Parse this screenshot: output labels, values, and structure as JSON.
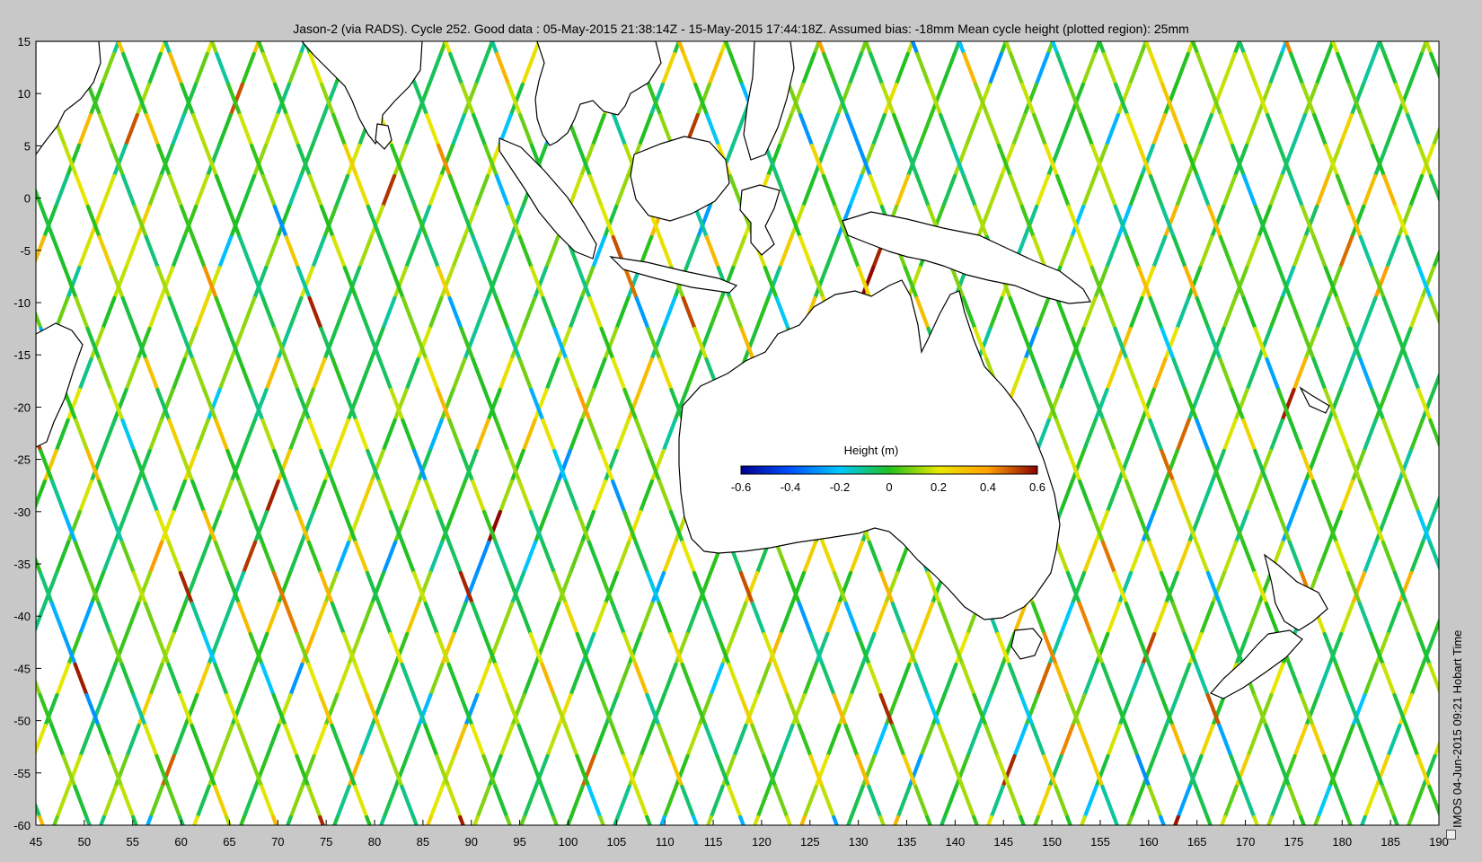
{
  "title": "Jason-2 (via RADS). Cycle 252. Good data : 05-May-2015 21:38:14Z - 15-May-2015 17:44:18Z. Assumed bias: -18mm  Mean cycle height (plotted region): 25mm",
  "credit": "IMOS 04-Jun-2015 09:21 Hobart Time",
  "colorbar": {
    "label": "Height (m)",
    "ticks": [
      "-0.6",
      "-0.4",
      "-0.2",
      "0",
      "0.2",
      "0.4",
      "0.6"
    ],
    "range": [
      -0.6,
      0.6
    ],
    "colors": [
      "#00008f",
      "#0050ff",
      "#00c8ff",
      "#20c020",
      "#e8e800",
      "#ffa000",
      "#8b0000"
    ]
  },
  "axes": {
    "lon_ticks": [
      "45",
      "50",
      "55",
      "60",
      "65",
      "70",
      "75",
      "80",
      "85",
      "90",
      "95",
      "100",
      "105",
      "110",
      "115",
      "120",
      "125",
      "130",
      "135",
      "140",
      "145",
      "150",
      "155",
      "160",
      "165",
      "170",
      "175",
      "180",
      "185",
      "190"
    ],
    "lat_ticks": [
      "15",
      "10",
      "5",
      "0",
      "-5",
      "-10",
      "-15",
      "-20",
      "-25",
      "-30",
      "-35",
      "-40",
      "-45",
      "-50",
      "-55",
      "-60"
    ],
    "lon_range": [
      45,
      190
    ],
    "lat_range": [
      -60,
      15
    ]
  },
  "icons": [
    "checkbox-icon"
  ]
}
